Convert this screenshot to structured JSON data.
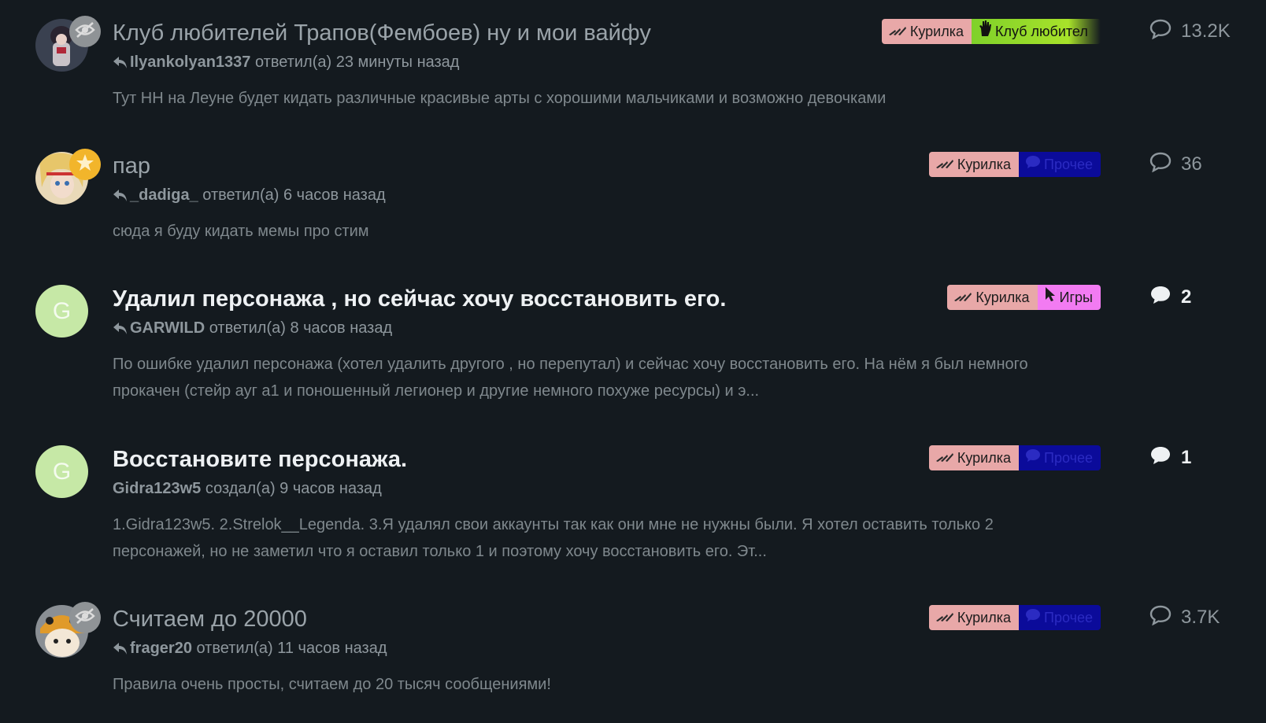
{
  "topics": [
    {
      "title": "Клуб любителей Трапов(Фембоев) ну и мои вайфу",
      "user": "Ilyankolyan1337",
      "action": "ответил(а) 23 минуты назад",
      "excerpt": "Тут НН на Леуне будет кидать различные красивые арты с хорошими мальчиками и возможно девочками",
      "tag1": "Курилка",
      "tag2": "Клуб любител",
      "replies": "13.2K"
    },
    {
      "title": "пар",
      "user": "_dadiga_",
      "action": "ответил(а) 6 часов назад",
      "excerpt": "сюда я буду кидать мемы про стим",
      "tag1": "Курилка",
      "tag2": "Прочее",
      "replies": "36"
    },
    {
      "title": "Удалил персонажа , но сейчас хочу восстановить его.",
      "avatar_letter": "G",
      "user": "GARWILD",
      "action": "ответил(а) 8 часов назад",
      "excerpt": "По ошибке удалил персонажа (хотел удалить другого , но перепутал) и сейчас хочу восстановить его. На нём я был немного прокачен (стейр ауг а1 и поношенный легионер и другие немного похуже ресурсы) и э...",
      "tag1": "Курилка",
      "tag2": "Игры",
      "replies": "2"
    },
    {
      "title": "Восстановите персонажа.",
      "avatar_letter": "G",
      "user": "Gidra123w5",
      "action": "создал(а) 9 часов назад",
      "excerpt": "1.Gidra123w5. 2.Strelok__Legenda. 3.Я удалял свои аккаунты так как они мне не нужны были. Я хотел оставить только 2 персонажей, но не заметил что я оставил только 1 и поэтому хочу восстановить его. Эт...",
      "tag1": "Курилка",
      "tag2": "Прочее",
      "replies": "1"
    },
    {
      "title": "Считаем до 20000",
      "user": "frager20",
      "action": "ответил(а) 11 часов назад",
      "excerpt": "Правила очень просты, считаем до 20 тысяч сообщениями!",
      "tag1": "Курилка",
      "tag2": "Прочее",
      "replies": "3.7K"
    }
  ],
  "colors": {
    "background": "#141a1f",
    "kurilka_tag": "#e8a8a8",
    "club_tag": "#8fd62a",
    "prochee_tag": "#0b0b9a",
    "games_tag": "#f27bf2",
    "letter_avatar": "#c6e8a6",
    "star_badge": "#f2b52b"
  },
  "icons": [
    "eye-slash-icon",
    "star-icon",
    "reply-icon",
    "kurilka-icon",
    "hand-icon",
    "comment-icon",
    "cursor-icon"
  ]
}
